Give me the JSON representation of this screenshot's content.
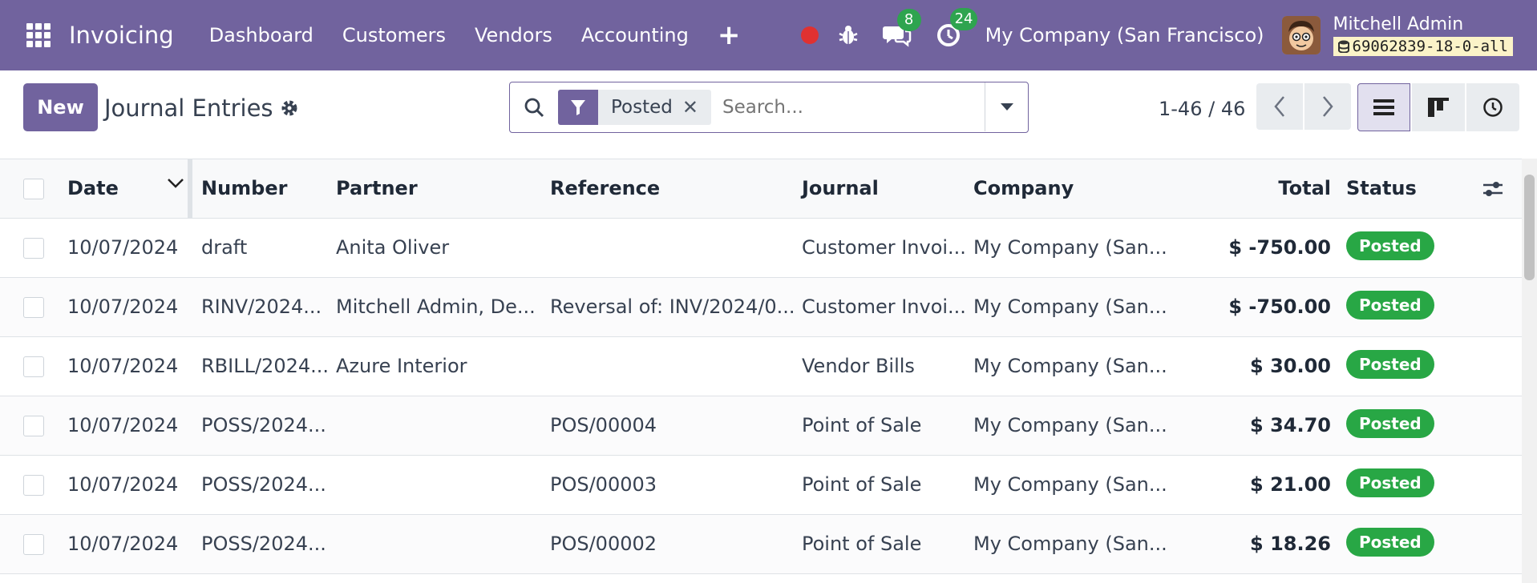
{
  "navbar": {
    "app_name": "Invoicing",
    "menu": [
      "Dashboard",
      "Customers",
      "Vendors",
      "Accounting"
    ],
    "messages_count": "8",
    "activities_count": "24",
    "company": "My Company (San Francisco)",
    "user_name": "Mitchell Admin",
    "db_name": "69062839-18-0-all",
    "accent_color": "#71639e"
  },
  "control": {
    "new_label": "New",
    "title": "Journal Entries",
    "facet_label": "Posted",
    "search_placeholder": "Search...",
    "pager": "1-46 / 46"
  },
  "table": {
    "headers": {
      "date": "Date",
      "number": "Number",
      "partner": "Partner",
      "reference": "Reference",
      "journal": "Journal",
      "company": "Company",
      "total": "Total",
      "status": "Status"
    },
    "rows": [
      {
        "date": "10/07/2024",
        "number": "draft",
        "partner": "Anita Oliver",
        "reference": "",
        "journal": "Customer Invoi...",
        "company": "My Company (San...",
        "total": "$ -750.00",
        "status": "Posted"
      },
      {
        "date": "10/07/2024",
        "number": "RINV/2024...",
        "partner": "Mitchell Admin, De...",
        "reference": "Reversal of: INV/2024/0...",
        "journal": "Customer Invoi...",
        "company": "My Company (San...",
        "total": "$ -750.00",
        "status": "Posted"
      },
      {
        "date": "10/07/2024",
        "number": "RBILL/2024...",
        "partner": "Azure Interior",
        "reference": "",
        "journal": "Vendor Bills",
        "company": "My Company (San...",
        "total": "$ 30.00",
        "status": "Posted"
      },
      {
        "date": "10/07/2024",
        "number": "POSS/2024...",
        "partner": "",
        "reference": "POS/00004",
        "journal": "Point of Sale",
        "company": "My Company (San...",
        "total": "$ 34.70",
        "status": "Posted"
      },
      {
        "date": "10/07/2024",
        "number": "POSS/2024...",
        "partner": "",
        "reference": "POS/00003",
        "journal": "Point of Sale",
        "company": "My Company (San...",
        "total": "$ 21.00",
        "status": "Posted"
      },
      {
        "date": "10/07/2024",
        "number": "POSS/2024...",
        "partner": "",
        "reference": "POS/00002",
        "journal": "Point of Sale",
        "company": "My Company (San...",
        "total": "$ 18.26",
        "status": "Posted"
      }
    ],
    "status_color": "#28a745"
  }
}
